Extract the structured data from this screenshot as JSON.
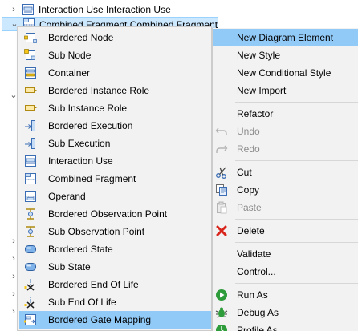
{
  "tree": {
    "rows": [
      {
        "label": "Interaction Use Interaction Use",
        "chevron": "›"
      },
      {
        "label": "Combined Fragment Combined Fragment",
        "chevron": "⌄"
      }
    ],
    "side_chevrons": [
      "⌄",
      "›",
      "›",
      "›",
      "›",
      "›"
    ]
  },
  "submenu": {
    "items": [
      {
        "label": "Bordered Node",
        "icon": "bordered-node-icon"
      },
      {
        "label": "Sub Node",
        "icon": "sub-node-icon"
      },
      {
        "label": "Container",
        "icon": "container-icon"
      },
      {
        "label": "Bordered Instance Role",
        "icon": "instance-role-icon"
      },
      {
        "label": "Sub Instance Role",
        "icon": "instance-role-icon"
      },
      {
        "label": "Bordered Execution",
        "icon": "execution-icon"
      },
      {
        "label": "Sub Execution",
        "icon": "execution-icon"
      },
      {
        "label": "Interaction Use",
        "icon": "interaction-use-icon"
      },
      {
        "label": "Combined Fragment",
        "icon": "combined-fragment-icon"
      },
      {
        "label": "Operand",
        "icon": "operand-icon"
      },
      {
        "label": "Bordered Observation Point",
        "icon": "observation-point-icon"
      },
      {
        "label": "Sub Observation Point",
        "icon": "observation-point-icon"
      },
      {
        "label": "Bordered State",
        "icon": "state-icon"
      },
      {
        "label": "Sub State",
        "icon": "state-icon"
      },
      {
        "label": "Bordered End Of Life",
        "icon": "end-of-life-icon"
      },
      {
        "label": "Sub End Of Life",
        "icon": "end-of-life-icon"
      },
      {
        "label": "Bordered Gate Mapping",
        "icon": "gate-mapping-icon"
      }
    ]
  },
  "context_menu": {
    "new_diagram_element": "New Diagram Element",
    "new_style": "New Style",
    "new_conditional_style": "New Conditional Style",
    "new_import": "New Import",
    "refactor": "Refactor",
    "undo": "Undo",
    "redo": "Redo",
    "cut": "Cut",
    "copy": "Copy",
    "paste": "Paste",
    "delete": "Delete",
    "validate": "Validate",
    "control": "Control...",
    "run_as": "Run As",
    "debug_as": "Debug As",
    "profile_as": "Profile As"
  },
  "colors": {
    "highlight": "#91c9f7",
    "menu_bg": "#f2f2f2",
    "tree_selection": "#cce8ff",
    "delete_red": "#d9241c",
    "run_green": "#2e9c3a"
  }
}
